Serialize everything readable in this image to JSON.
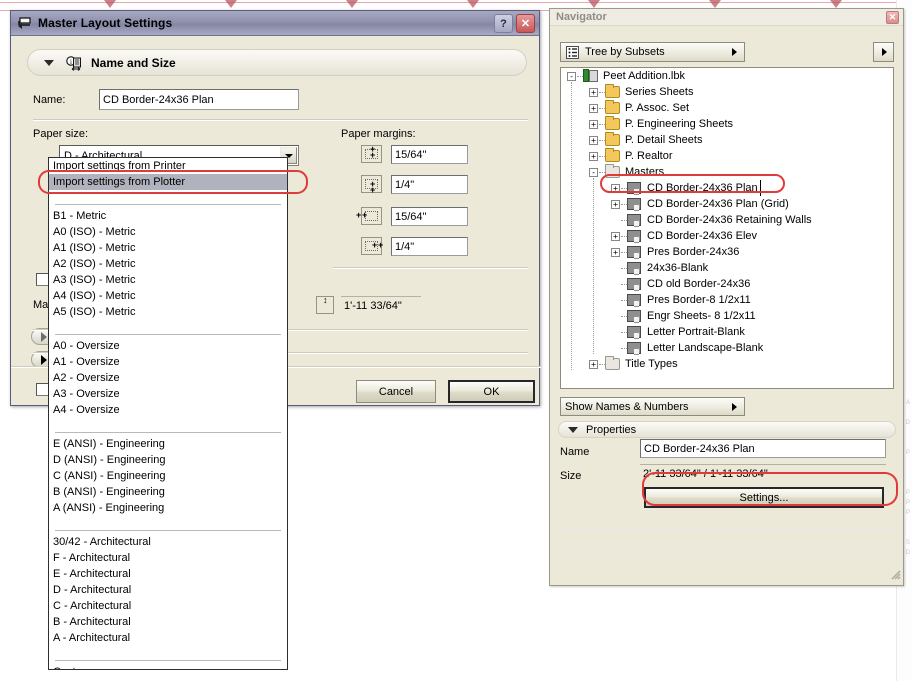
{
  "dialog": {
    "title": "Master Layout Settings",
    "icon": "layout-icon",
    "help_button": "?",
    "close_button": "✕",
    "section": {
      "label": "Name and Size",
      "icon": "info-page-icon"
    },
    "name_label": "Name:",
    "name_value": "CD Border-24x36 Plan",
    "paper_size_label": "Paper size:",
    "paper_size_value": "D - Architectural",
    "paper_margins_label": "Paper margins:",
    "margins": [
      {
        "icon": "margin-top-icon",
        "value": "15/64\""
      },
      {
        "icon": "margin-bottom-icon",
        "value": "1/4\""
      },
      {
        "icon": "margin-left-icon",
        "value": "15/64\""
      },
      {
        "icon": "margin-right-icon",
        "value": "1/4\""
      }
    ],
    "height_value": "1'-11 33/64\"",
    "masters_label": "Mast",
    "cancel_label": "Cancel",
    "ok_label": "OK"
  },
  "paper_size_dropdown": {
    "groups": [
      {
        "items": [
          {
            "label": "Import settings from Printer",
            "selected": false
          },
          {
            "label": "Import settings from Plotter",
            "selected": true
          }
        ]
      },
      {
        "items": [
          {
            "label": "B1 - Metric",
            "selected": false
          },
          {
            "label": "A0 (ISO) - Metric",
            "selected": false
          },
          {
            "label": "A1 (ISO) - Metric",
            "selected": false
          },
          {
            "label": "A2 (ISO) - Metric",
            "selected": false
          },
          {
            "label": "A3 (ISO) - Metric",
            "selected": false
          },
          {
            "label": "A4 (ISO) - Metric",
            "selected": false
          },
          {
            "label": "A5 (ISO) - Metric",
            "selected": false
          }
        ]
      },
      {
        "items": [
          {
            "label": "A0 - Oversize",
            "selected": false
          },
          {
            "label": "A1 - Oversize",
            "selected": false
          },
          {
            "label": "A2 - Oversize",
            "selected": false
          },
          {
            "label": "A3 - Oversize",
            "selected": false
          },
          {
            "label": "A4 - Oversize",
            "selected": false
          }
        ]
      },
      {
        "items": [
          {
            "label": "E (ANSI) - Engineering",
            "selected": false
          },
          {
            "label": "D (ANSI) - Engineering",
            "selected": false
          },
          {
            "label": "C (ANSI) - Engineering",
            "selected": false
          },
          {
            "label": "B (ANSI) - Engineering",
            "selected": false
          },
          {
            "label": "A (ANSI) - Engineering",
            "selected": false
          }
        ]
      },
      {
        "items": [
          {
            "label": "30/42 - Architectural",
            "selected": false
          },
          {
            "label": "F - Architectural",
            "selected": false
          },
          {
            "label": "E - Architectural",
            "selected": false
          },
          {
            "label": "D - Architectural",
            "selected": false
          },
          {
            "label": "C - Architectural",
            "selected": false
          },
          {
            "label": "B - Architectural",
            "selected": false
          },
          {
            "label": "A - Architectural",
            "selected": false
          }
        ]
      },
      {
        "items": [
          {
            "label": "Custom",
            "selected": false
          }
        ]
      }
    ]
  },
  "navigator": {
    "title": "Navigator",
    "close_button": "✕",
    "view_selector": "Tree by Subsets",
    "view_selector_icon": "tree-view-icon",
    "options_button_icon": "chevron-right-icon",
    "tree": [
      {
        "label": "Peet Addition.lbk",
        "depth": 0,
        "icon": "book-icon",
        "expander": "-"
      },
      {
        "label": "Series Sheets",
        "depth": 1,
        "icon": "folder-icon",
        "expander": "+"
      },
      {
        "label": "P.  Assoc. Set",
        "depth": 1,
        "icon": "folder-icon",
        "expander": "+"
      },
      {
        "label": "P. Engineering Sheets",
        "depth": 1,
        "icon": "folder-icon",
        "expander": "+"
      },
      {
        "label": "P. Detail Sheets",
        "depth": 1,
        "icon": "folder-icon",
        "expander": "+"
      },
      {
        "label": "P.  Realtor",
        "depth": 1,
        "icon": "folder-icon",
        "expander": "+"
      },
      {
        "label": "Masters",
        "depth": 1,
        "icon": "folder-open-icon",
        "expander": "-"
      },
      {
        "label": "CD Border-24x36 Plan",
        "depth": 2,
        "icon": "master-icon",
        "expander": "+",
        "selected": true
      },
      {
        "label": "CD Border-24x36 Plan (Grid)",
        "depth": 2,
        "icon": "master-icon",
        "expander": "+"
      },
      {
        "label": "CD Border-24x36 Retaining Walls",
        "depth": 2,
        "icon": "master-icon",
        "expander": ""
      },
      {
        "label": "CD Border-24x36 Elev",
        "depth": 2,
        "icon": "master-icon",
        "expander": "+"
      },
      {
        "label": "Pres Border-24x36",
        "depth": 2,
        "icon": "master-icon",
        "expander": "+"
      },
      {
        "label": "24x36-Blank",
        "depth": 2,
        "icon": "master-icon",
        "expander": ""
      },
      {
        "label": "CD old Border-24x36",
        "depth": 2,
        "icon": "master-icon",
        "expander": ""
      },
      {
        "label": "Pres Border-8 1/2x11",
        "depth": 2,
        "icon": "master-icon",
        "expander": ""
      },
      {
        "label": "Engr Sheets- 8 1/2x11",
        "depth": 2,
        "icon": "master-icon",
        "expander": ""
      },
      {
        "label": "Letter Portrait-Blank",
        "depth": 2,
        "icon": "master-icon",
        "expander": ""
      },
      {
        "label": "Letter Landscape-Blank",
        "depth": 2,
        "icon": "master-icon",
        "expander": ""
      },
      {
        "label": "Title Types",
        "depth": 1,
        "icon": "folder-grey-icon",
        "expander": "+"
      }
    ],
    "names_numbers_button": "Show Names & Numbers",
    "properties": {
      "header": "Properties",
      "name_label": "Name",
      "name_value": "CD Border-24x36 Plan",
      "size_label": "Size",
      "size_value": "2'-11 33/64\" / 1'-11 33/64\"",
      "settings_button": "Settings..."
    }
  },
  "annotations": {
    "color": "#e03a3a",
    "targets": [
      "import-settings-from-plotter",
      "tree-item-cd-border-24x36-plan",
      "settings-button"
    ]
  }
}
